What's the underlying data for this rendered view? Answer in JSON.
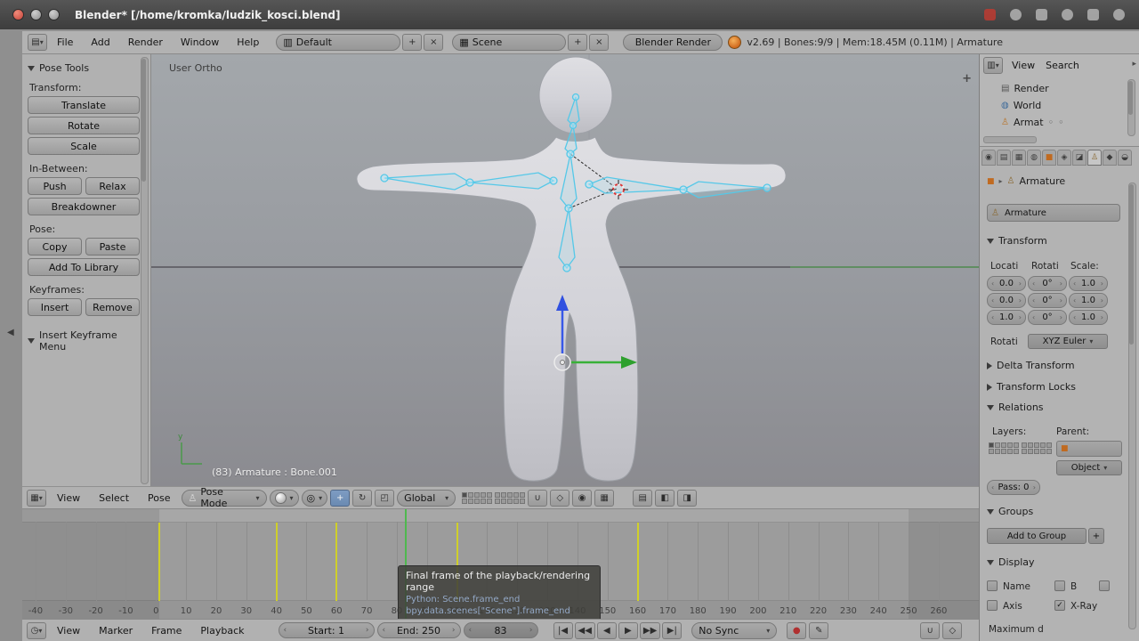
{
  "titlebar": {
    "title": "Blender* [/home/kromka/ludzik_kosci.blend]"
  },
  "infobar": {
    "menus": [
      {
        "label": "File"
      },
      {
        "label": "Add"
      },
      {
        "label": "Render"
      },
      {
        "label": "Window"
      },
      {
        "label": "Help"
      }
    ],
    "layout": "Default",
    "scene": "Scene",
    "engine": "Blender Render",
    "stats": "v2.69 | Bones:9/9 | Mem:18.45M (0.11M) | Armature"
  },
  "tool_shelf": {
    "panel_title": "Pose Tools",
    "transform_label": "Transform:",
    "inbetween_label": "In-Between:",
    "pose_label": "Pose:",
    "keyframes_label": "Keyframes:",
    "insert_keyframe_menu": "Insert Keyframe Menu",
    "buttons": {
      "translate": "Translate",
      "rotate": "Rotate",
      "scale": "Scale",
      "push": "Push",
      "relax": "Relax",
      "breakdowner": "Breakdowner",
      "copy": "Copy",
      "paste": "Paste",
      "add_to_library": "Add To Library",
      "insert": "Insert",
      "remove": "Remove"
    }
  },
  "viewport": {
    "view_name": "User Ortho",
    "active_info": "(83) Armature : Bone.001",
    "header": {
      "view": "View",
      "select": "Select",
      "pose": "Pose",
      "mode": "Pose Mode",
      "orientation": "Global"
    }
  },
  "timeline": {
    "frame_start": 1,
    "frame_end": 250,
    "current_frame": 83,
    "keyframes": [
      1,
      40,
      60,
      100,
      160
    ],
    "ticks": {
      "start": -40,
      "end": 260,
      "step": 10
    },
    "header": {
      "view": "View",
      "marker": "Marker",
      "frame": "Frame",
      "playback": "Playback",
      "start": "Start: 1",
      "end": "End: 250",
      "current": "83",
      "sync": "No Sync"
    },
    "tooltip": {
      "title": "Final frame of the playback/rendering range",
      "line1": "Python: Scene.frame_end",
      "line2": "bpy.data.scenes[\"Scene\"].frame_end"
    }
  },
  "outliner": {
    "view": "View",
    "search": "Search",
    "items": [
      {
        "label": "Render"
      },
      {
        "label": "World"
      },
      {
        "label": "Armat"
      }
    ]
  },
  "properties": {
    "breadcrumb": "Armature",
    "name": "Armature",
    "transform": {
      "title": "Transform",
      "cols": [
        "Locati",
        "Rotati",
        "Scale:"
      ],
      "rows": [
        [
          "0.0",
          "0°",
          "1.0"
        ],
        [
          "0.0",
          "0°",
          "1.0"
        ],
        [
          "1.0",
          "0°",
          "1.0"
        ]
      ],
      "rot_label": "Rotati",
      "rot_mode": "XYZ Euler"
    },
    "delta_transform": "Delta Transform",
    "transform_locks": "Transform Locks",
    "relations": {
      "title": "Relations",
      "layers": "Layers:",
      "parent": "Parent:",
      "object": "Object",
      "pass": "Pass: 0"
    },
    "groups": {
      "title": "Groups",
      "add": "Add to Group"
    },
    "display": {
      "title": "Display",
      "name": "Name",
      "b": "B",
      "axis": "Axis",
      "xray": "X-Ray",
      "maximum": "Maximum d"
    }
  },
  "icons": {
    "editor_info": "▤",
    "editor_3d": "▦",
    "editor_timeline": "◷",
    "editor_outliner": "▥",
    "dropdown": "▾",
    "collapse_left": "◀",
    "expand_plus": "+",
    "plus": "+",
    "close": "×",
    "pose_figure": "♙",
    "pivot": "◎",
    "rotate_tool": "↻",
    "scale_tool": "◰",
    "translate_tool": "+",
    "magnet": "∪",
    "snap_element": "◇",
    "render_still": "◉",
    "render_anim": "▦",
    "jump_start": "|◀",
    "prev_key": "◀◀",
    "play_rev": "◀",
    "play": "▶",
    "next_key": "▶▶",
    "jump_end": "▶|",
    "record": "●",
    "pencil": "✎",
    "world": "◍",
    "render_layer": "▤",
    "arrow_right": "▸",
    "dots": "◦",
    "tab_render": "◉",
    "tab_layers": "▤",
    "tab_scene": "▦",
    "tab_world": "◍",
    "tab_object": "■",
    "tab_constraint": "◈",
    "tab_modifier": "◪",
    "tab_data": "♙",
    "tab_bone": "◆",
    "tab_physics": "◒",
    "extra1": "▤",
    "extra2": "◧",
    "extra3": "◨"
  }
}
